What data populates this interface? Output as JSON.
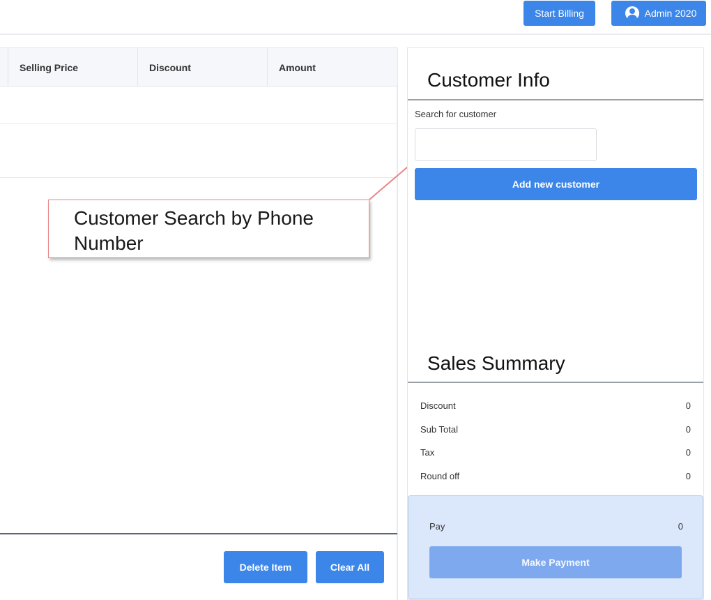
{
  "topbar": {
    "start_billing_label": "Start Billing",
    "user_label": "Admin 2020",
    "user_icon": "user-circle-icon"
  },
  "items_table": {
    "columns": [
      "Selling Price",
      "Discount",
      "Amount"
    ],
    "delete_label": "Delete Item",
    "clear_label": "Clear All"
  },
  "annotation": {
    "text": "Customer Search by Phone Number",
    "border_color": "#e98585"
  },
  "customer_info": {
    "title": "Customer Info",
    "search_label": "Search for customer",
    "search_value": "",
    "add_label": "Add new customer"
  },
  "sales_summary": {
    "title": "Sales Summary",
    "rows": [
      {
        "label": "Discount",
        "value": "0"
      },
      {
        "label": "Sub Total",
        "value": "0"
      },
      {
        "label": "Tax",
        "value": "0"
      },
      {
        "label": "Round off",
        "value": "0"
      }
    ],
    "pay_label": "Pay",
    "pay_value": "0",
    "make_payment_label": "Make Payment"
  },
  "colors": {
    "primary": "#3b86e8",
    "pay_panel": "#dbe8fb",
    "disabled_button": "#7ea9ee"
  }
}
